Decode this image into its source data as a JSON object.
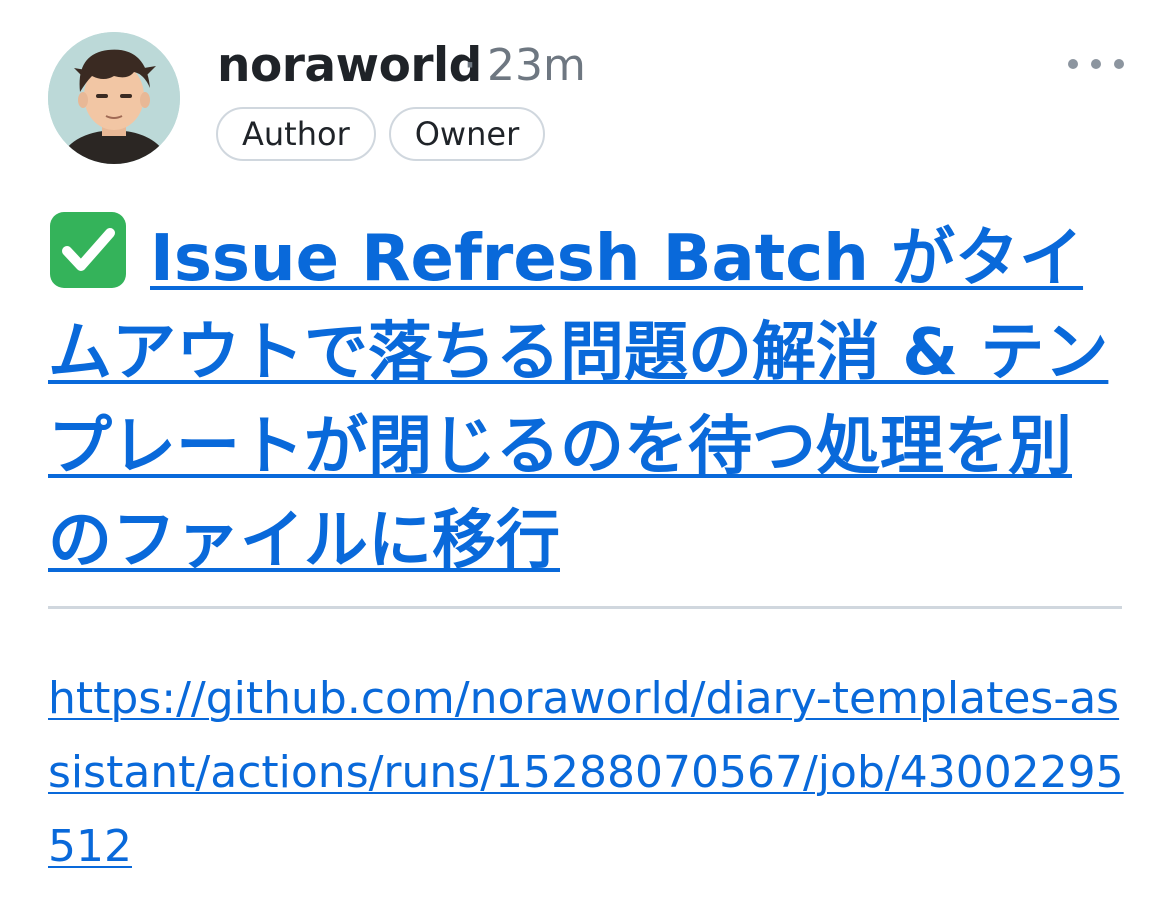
{
  "comment": {
    "author": {
      "username": "noraworld",
      "avatar_icon": "avatar-illustration"
    },
    "separator": "·",
    "timestamp": "23m",
    "badges": [
      {
        "label": "Author"
      },
      {
        "label": "Owner"
      }
    ],
    "more_icon": "more-horizontal-icon",
    "status_icon": "check-mark-button-icon",
    "title": "Issue Refresh Batch がタイムアウトで落ちる問題の解消 & テンプレートが閉じるのを待つ処理を別のファイルに移行",
    "body_link": "https://github.com/noraworld/diary-templates-assistant/actions/runs/15288070567/job/43002295512"
  },
  "colors": {
    "link": "#0969da",
    "muted": "#6e7781",
    "badge_border": "#d0d7de",
    "check_green": "#34b35a"
  }
}
